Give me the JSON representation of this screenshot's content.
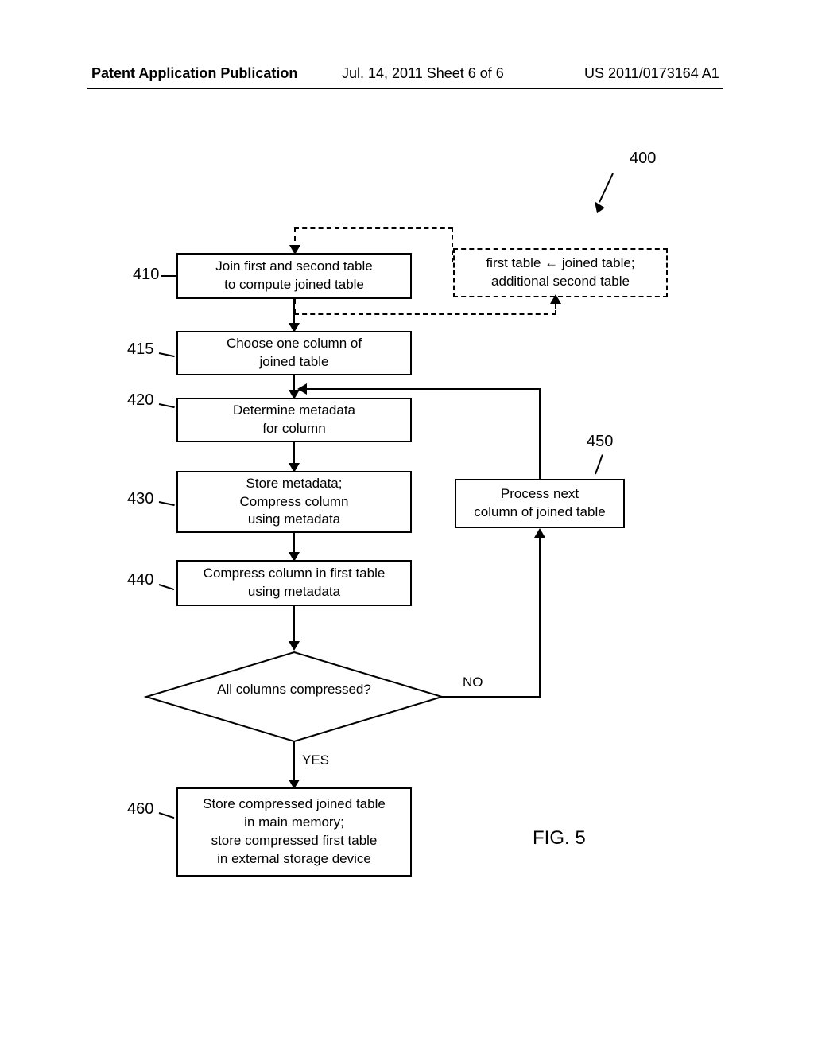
{
  "header": {
    "left": "Patent Application Publication",
    "mid": "Jul. 14, 2011  Sheet 6 of 6",
    "right": "US 2011/0173164 A1"
  },
  "figure": {
    "ref": "400",
    "label": "FIG. 5"
  },
  "labels": {
    "l410": "410",
    "l415": "415",
    "l420": "420",
    "l430": "430",
    "l440": "440",
    "l450": "450",
    "l460": "460"
  },
  "boxes": {
    "loopbox": "first table ← joined table;\nadditional second table",
    "b410": "Join first and second table\nto compute joined table",
    "b415": "Choose one column of\njoined table",
    "b420": "Determine metadata\nfor column",
    "b430": "Store metadata;\nCompress column\nusing metadata",
    "b440": "Compress column in first table\nusing metadata",
    "b450": "Process next\ncolumn of joined table",
    "b460": "Store compressed joined table\nin main memory;\nstore compressed first table\nin external storage device"
  },
  "decision": {
    "text": "All columns\ncompressed?",
    "yes": "YES",
    "no": "NO"
  }
}
